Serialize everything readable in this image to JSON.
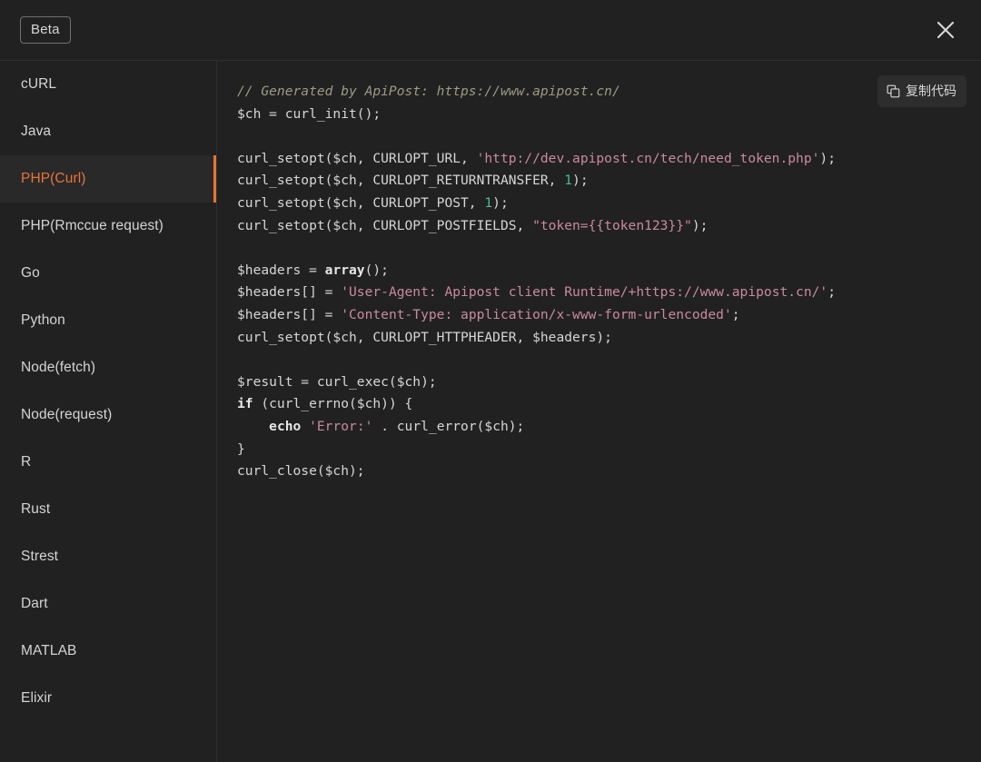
{
  "header": {
    "beta_label": "Beta",
    "close_icon": "close-icon"
  },
  "sidebar": {
    "items": [
      {
        "label": "cURL",
        "active": false
      },
      {
        "label": "Java",
        "active": false
      },
      {
        "label": "PHP(Curl)",
        "active": true
      },
      {
        "label": "PHP(Rmccue request)",
        "active": false
      },
      {
        "label": "Go",
        "active": false
      },
      {
        "label": "Python",
        "active": false
      },
      {
        "label": "Node(fetch)",
        "active": false
      },
      {
        "label": "Node(request)",
        "active": false
      },
      {
        "label": "R",
        "active": false
      },
      {
        "label": "Rust",
        "active": false
      },
      {
        "label": "Strest",
        "active": false
      },
      {
        "label": "Dart",
        "active": false
      },
      {
        "label": "MATLAB",
        "active": false
      },
      {
        "label": "Elixir",
        "active": false
      }
    ],
    "active_item": "PHP(Curl)",
    "accent_color": "#e8762d"
  },
  "code_panel": {
    "copy_button_label": "复制代码",
    "copy_icon": "copy-icon",
    "language": "PHP(Curl)",
    "code_text": "// Generated by ApiPost: https://www.apipost.cn/\n$ch = curl_init();\n\ncurl_setopt($ch, CURLOPT_URL, 'http://dev.apipost.cn/tech/need_token.php');\ncurl_setopt($ch, CURLOPT_RETURNTRANSFER, 1);\ncurl_setopt($ch, CURLOPT_POST, 1);\ncurl_setopt($ch, CURLOPT_POSTFIELDS, \"token={{token123}}\");\n\n$headers = array();\n$headers[] = 'User-Agent: Apipost client Runtime/+https://www.apipost.cn/';\n$headers[] = 'Content-Type: application/x-www-form-urlencoded';\ncurl_setopt($ch, CURLOPT_HTTPHEADER, $headers);\n\n$result = curl_exec($ch);\nif (curl_errno($ch)) {\n    echo 'Error:' . curl_error($ch);\n}\ncurl_close($ch);",
    "code_tokens": [
      [
        {
          "t": "comment",
          "v": "// Generated by ApiPost: https://www.apipost.cn/"
        }
      ],
      [
        {
          "t": "plain",
          "v": "$ch = curl_init();"
        }
      ],
      [],
      [
        {
          "t": "plain",
          "v": "curl_setopt($ch, CURLOPT_URL, "
        },
        {
          "t": "string",
          "v": "'http://dev.apipost.cn/tech/need_token.php'"
        },
        {
          "t": "plain",
          "v": ");"
        }
      ],
      [
        {
          "t": "plain",
          "v": "curl_setopt($ch, CURLOPT_RETURNTRANSFER, "
        },
        {
          "t": "number",
          "v": "1"
        },
        {
          "t": "plain",
          "v": ");"
        }
      ],
      [
        {
          "t": "plain",
          "v": "curl_setopt($ch, CURLOPT_POST, "
        },
        {
          "t": "number",
          "v": "1"
        },
        {
          "t": "plain",
          "v": ");"
        }
      ],
      [
        {
          "t": "plain",
          "v": "curl_setopt($ch, CURLOPT_POSTFIELDS, "
        },
        {
          "t": "string",
          "v": "\"token={{token123}}\""
        },
        {
          "t": "plain",
          "v": ");"
        }
      ],
      [],
      [
        {
          "t": "plain",
          "v": "$headers = "
        },
        {
          "t": "kw",
          "v": "array"
        },
        {
          "t": "plain",
          "v": "();"
        }
      ],
      [
        {
          "t": "plain",
          "v": "$headers[] = "
        },
        {
          "t": "string",
          "v": "'User-Agent: Apipost client Runtime/+https://www.apipost.cn/'"
        },
        {
          "t": "plain",
          "v": ";"
        }
      ],
      [
        {
          "t": "plain",
          "v": "$headers[] = "
        },
        {
          "t": "string",
          "v": "'Content-Type: application/x-www-form-urlencoded'"
        },
        {
          "t": "plain",
          "v": ";"
        }
      ],
      [
        {
          "t": "plain",
          "v": "curl_setopt($ch, CURLOPT_HTTPHEADER, $headers);"
        }
      ],
      [],
      [
        {
          "t": "plain",
          "v": "$result = curl_exec($ch);"
        }
      ],
      [
        {
          "t": "kw",
          "v": "if"
        },
        {
          "t": "plain",
          "v": " (curl_errno($ch)) {"
        }
      ],
      [
        {
          "t": "plain",
          "v": "    "
        },
        {
          "t": "kw",
          "v": "echo"
        },
        {
          "t": "plain",
          "v": " "
        },
        {
          "t": "string",
          "v": "'Error:'"
        },
        {
          "t": "plain",
          "v": " . curl_error($ch);"
        }
      ],
      [
        {
          "t": "plain",
          "v": "}"
        }
      ],
      [
        {
          "t": "plain",
          "v": "curl_close($ch);"
        }
      ]
    ],
    "syntax_colors": {
      "comment": "#9b9b86",
      "string": "#c98a9e",
      "number": "#49b999",
      "keyword": "#e6e6e6",
      "plain": "#d6d6d6",
      "background": "#212121"
    }
  }
}
